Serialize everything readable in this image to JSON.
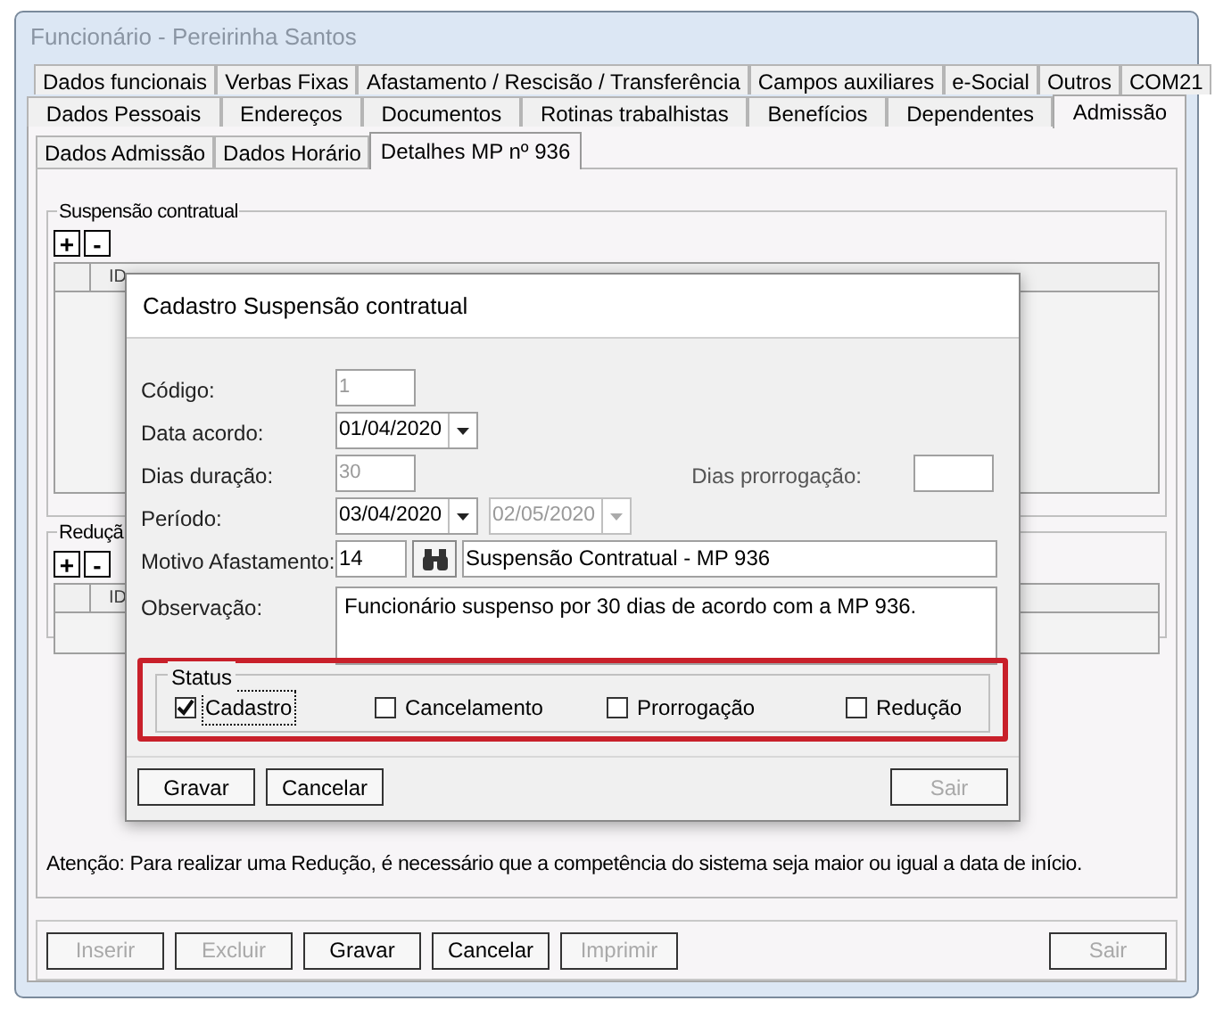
{
  "window": {
    "title": "Funcionário - Pereirinha Santos"
  },
  "tab_rows": [
    [
      {
        "label": "Dados funcionais",
        "selected": false
      },
      {
        "label": "Verbas Fixas",
        "selected": false
      },
      {
        "label": "Afastamento / Rescisão / Transferência",
        "selected": false
      },
      {
        "label": "Campos auxiliares",
        "selected": false
      },
      {
        "label": "e-Social",
        "selected": false
      },
      {
        "label": "Outros",
        "selected": false
      },
      {
        "label": "COM21",
        "selected": false
      }
    ],
    [
      {
        "label": "Dados Pessoais",
        "selected": false
      },
      {
        "label": "Endereços",
        "selected": false
      },
      {
        "label": "Documentos",
        "selected": false
      },
      {
        "label": "Rotinas trabalhistas",
        "selected": false
      },
      {
        "label": "Benefícios",
        "selected": false
      },
      {
        "label": "Dependentes",
        "selected": false
      },
      {
        "label": "Admissão",
        "selected": true
      }
    ]
  ],
  "sub_tabs": [
    {
      "label": "Dados Admissão",
      "selected": false
    },
    {
      "label": "Dados Horário",
      "selected": false
    },
    {
      "label": "Detalhes MP nº 936",
      "selected": true
    }
  ],
  "groups": [
    {
      "title": "Suspensão contratual",
      "add": "+",
      "remove": "-",
      "column": "ID"
    },
    {
      "title": "Reduçã",
      "add": "+",
      "remove": "-",
      "column": "ID"
    }
  ],
  "note": "Atenção: Para realizar uma Redução, é necessário que a competência do sistema seja maior ou igual a data de início.",
  "buttons": [
    {
      "label": "Inserir",
      "disabled": true
    },
    {
      "label": "Excluir",
      "disabled": true
    },
    {
      "label": "Gravar",
      "disabled": false
    },
    {
      "label": "Cancelar",
      "disabled": false
    },
    {
      "label": "Imprimir",
      "disabled": true
    },
    {
      "label": "Sair",
      "disabled": true
    }
  ],
  "dialog": {
    "title": "Cadastro Suspensão contratual",
    "fields": [
      {
        "kind": "text",
        "label": "Código:",
        "value": "1",
        "disabled": true
      },
      {
        "kind": "date",
        "label": "Data acordo:",
        "value": "01/04/2020",
        "disabled": false
      },
      {
        "kind": "text",
        "label": "Dias duração:",
        "value": "30",
        "disabled": true,
        "side_label": "Dias prorrogação:"
      },
      {
        "kind": "range",
        "label": "Período:",
        "value": "03/04/2020",
        "disabled": false,
        "end_value": "02/05/2020",
        "end_disabled": true
      },
      {
        "kind": "lookup",
        "label": "Motivo Afastamento:",
        "value": "14",
        "description": "Suspensão Contratual - MP 936",
        "disabled": false
      },
      {
        "kind": "memo",
        "label": "Observação:",
        "value": "Funcionário suspenso por 30 dias de acordo com a MP 936.",
        "disabled": false
      }
    ],
    "status": {
      "title": "Status",
      "highlighted": true,
      "options": [
        {
          "label": "Cadastro",
          "checked": true,
          "focused": true
        },
        {
          "label": "Cancelamento",
          "checked": false,
          "focused": false
        },
        {
          "label": "Prorrogação",
          "checked": false,
          "focused": false
        },
        {
          "label": "Redução",
          "checked": false,
          "focused": false
        }
      ]
    },
    "buttons": [
      {
        "label": "Gravar",
        "disabled": false
      },
      {
        "label": "Cancelar",
        "disabled": false
      },
      {
        "label": "Sair",
        "disabled": true
      }
    ]
  }
}
